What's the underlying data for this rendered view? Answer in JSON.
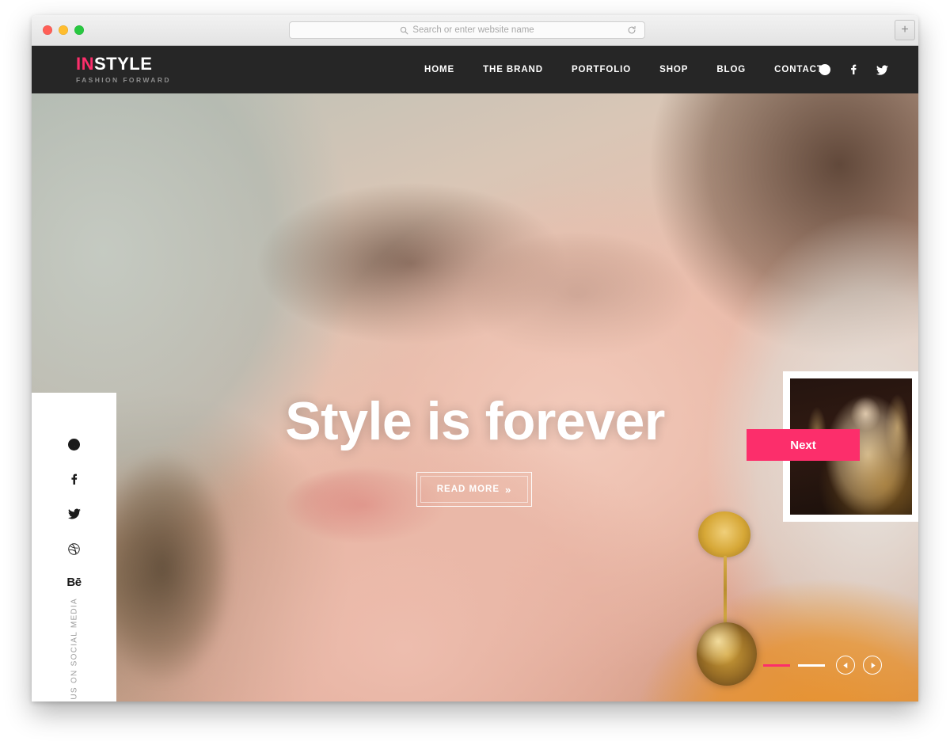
{
  "browser": {
    "traffic_lights": [
      "close",
      "minimize",
      "maximize"
    ],
    "address_placeholder": "Search or enter website name",
    "address_value": "",
    "search_icon": "search-icon",
    "reload_icon": "reload-icon",
    "new_tab_label": "+"
  },
  "header": {
    "logo": {
      "part_accent": "IN",
      "part_main": "STYLE",
      "tagline": "FASHION FORWARD",
      "accent_color": "#fc2e6b"
    },
    "nav": [
      {
        "label": "HOME"
      },
      {
        "label": "THE BRAND"
      },
      {
        "label": "PORTFOLIO"
      },
      {
        "label": "SHOP"
      },
      {
        "label": "BLOG"
      },
      {
        "label": "CONTACT"
      }
    ],
    "social": [
      {
        "name": "pinterest-icon"
      },
      {
        "name": "facebook-icon"
      },
      {
        "name": "twitter-icon"
      }
    ],
    "background_color": "#262626"
  },
  "hero": {
    "headline": "Style is forever",
    "cta_label": "READ MORE",
    "cta_chevron": "»"
  },
  "sidebar": {
    "social": [
      {
        "name": "pinterest-icon"
      },
      {
        "name": "facebook-icon"
      },
      {
        "name": "twitter-icon"
      },
      {
        "name": "dribbble-icon"
      },
      {
        "name": "behance-icon",
        "glyph": "Bē"
      }
    ],
    "follow_text": "FOLLOW US ON SOCIAL MEDIA"
  },
  "next_slide": {
    "label": "Next",
    "label_color": "#fc2e6b"
  },
  "slider": {
    "indicators": [
      {
        "state": "active",
        "color": "#fc2e6b"
      },
      {
        "state": "inactive",
        "color": "#ffffff"
      }
    ],
    "prev_icon": "chevron-left-icon",
    "next_icon": "chevron-right-icon"
  }
}
